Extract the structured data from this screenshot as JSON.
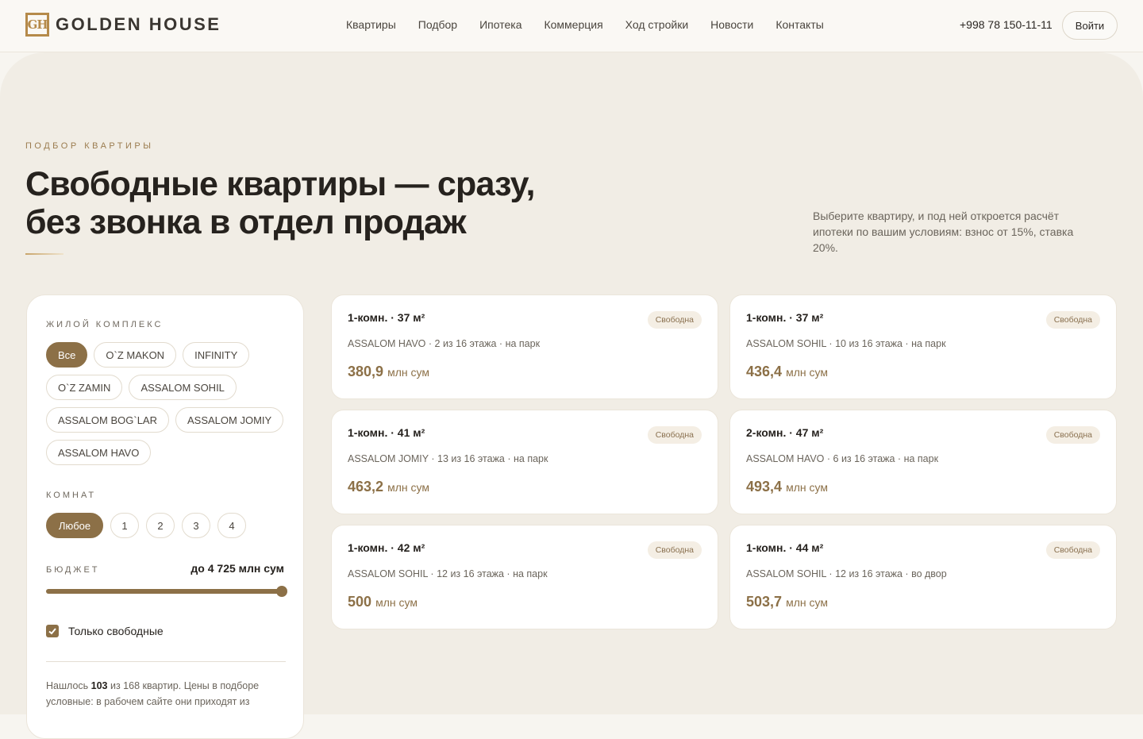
{
  "header": {
    "logo_mark": "GH",
    "logo_text": "GOLDEN HOUSE",
    "nav": [
      "Квартиры",
      "Подбор",
      "Ипотека",
      "Коммерция",
      "Ход стройки",
      "Новости",
      "Контакты"
    ],
    "phone": "+998 78 150-11-11",
    "login_label": "Войти"
  },
  "hero": {
    "eyebrow": "ПОДБОР КВАРТИРЫ",
    "title_line1": "Свободные квартиры — сразу,",
    "title_line2": "без звонка в отдел продаж",
    "intro": "Выберите квартиру, и под ней откроется расчёт ипотеки по вашим условиям: взнос от 15%, ставка 20%."
  },
  "filter": {
    "complex_label": "ЖИЛОЙ КОМПЛЕКС",
    "complexes": [
      "Все",
      "O`Z MAKON",
      "INFINITY",
      "O`Z ZAMIN",
      "ASSALOM SOHIL",
      "ASSALOM BOG`LAR",
      "ASSALOM JOMIY",
      "ASSALOM HAVO"
    ],
    "complex_selected": "Все",
    "rooms_label": "КОМНАТ",
    "rooms": [
      "Любое",
      "1",
      "2",
      "3",
      "4"
    ],
    "rooms_selected": "Любое",
    "budget_label": "БЮДЖЕТ",
    "budget_value": "до 4 725 млн сум",
    "budget_fraction": 1.0,
    "only_free_label": "Только свободные",
    "only_free_checked": true,
    "found_prefix": "Нашлось ",
    "found_count": "103",
    "found_suffix": " из 168 квартир. Цены в подборе условные: в рабочем сайте они приходят из"
  },
  "listings": [
    {
      "title": "1-комн. · 37 м²",
      "badge": "Свободна",
      "sub": "ASSALOM HAVO · 2 из 16 этажа · на парк",
      "price": "380,9",
      "unit": "млн сум"
    },
    {
      "title": "1-комн. · 37 м²",
      "badge": "Свободна",
      "sub": "ASSALOM SOHIL · 10 из 16 этажа · на парк",
      "price": "436,4",
      "unit": "млн сум"
    },
    {
      "title": "1-комн. · 41 м²",
      "badge": "Свободна",
      "sub": "ASSALOM JOMIY · 13 из 16 этажа · на парк",
      "price": "463,2",
      "unit": "млн сум"
    },
    {
      "title": "2-комн. · 47 м²",
      "badge": "Свободна",
      "sub": "ASSALOM HAVO · 6 из 16 этажа · на парк",
      "price": "493,4",
      "unit": "млн сум"
    },
    {
      "title": "1-комн. · 42 м²",
      "badge": "Свободна",
      "sub": "ASSALOM SOHIL · 12 из 16 этажа · на парк",
      "price": "500",
      "unit": "млн сум"
    },
    {
      "title": "1-комн. · 44 м²",
      "badge": "Свободна",
      "sub": "ASSALOM SOHIL · 12 из 16 этажа · во двор",
      "price": "503,7",
      "unit": "млн сум"
    }
  ],
  "colors": {
    "accent": "#8c7047",
    "background": "#f1ede5",
    "logo": "#b58a4a"
  }
}
